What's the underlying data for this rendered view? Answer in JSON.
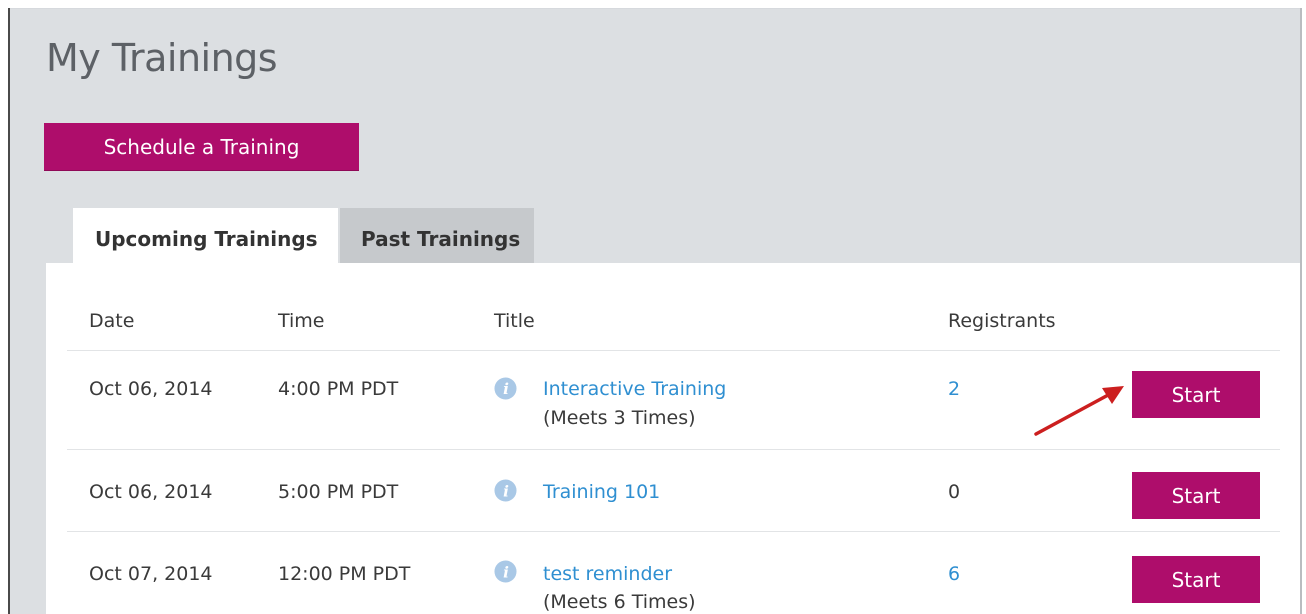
{
  "page": {
    "title": "My Trainings",
    "schedule_button": "Schedule a Training"
  },
  "tabs": [
    {
      "label": "Upcoming Trainings",
      "active": true
    },
    {
      "label": "Past Trainings",
      "active": false
    }
  ],
  "table": {
    "columns": [
      "Date",
      "Time",
      "Title",
      "Registrants"
    ],
    "rows": [
      {
        "date": "Oct 06, 2014",
        "time": "4:00 PM PDT",
        "title": "Interactive Training",
        "meets": "(Meets 3 Times)",
        "registrants": "2",
        "registrants_link": true,
        "action": "Start"
      },
      {
        "date": "Oct 06, 2014",
        "time": "5:00 PM PDT",
        "title": "Training 101",
        "meets": "",
        "registrants": "0",
        "registrants_link": false,
        "action": "Start"
      },
      {
        "date": "Oct 07, 2014",
        "time": "12:00 PM PDT",
        "title": "test reminder",
        "meets": "(Meets 6 Times)",
        "registrants": "6",
        "registrants_link": true,
        "action": "Start"
      }
    ]
  },
  "icons": {
    "info": "info-icon",
    "annotation": "red-arrow-icon"
  },
  "colors": {
    "brand": "#ae0d6b",
    "link": "#2f8fd1",
    "panel": "#dcdfe2",
    "info_icon": "#a9c8e6",
    "annotation": "#cc1f1f"
  }
}
